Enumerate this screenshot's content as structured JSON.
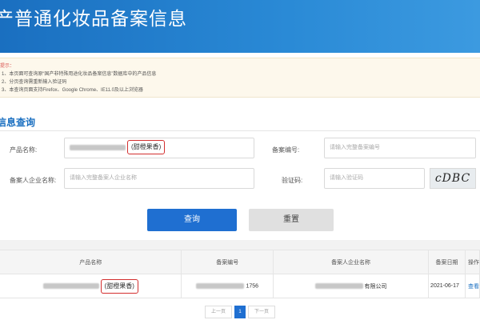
{
  "header": {
    "title": "产普通化妆品备案信息"
  },
  "notice": {
    "title": "提示：",
    "lines": [
      "1、本页面可查询原“国产非特殊用途化妆品备案信息”数据库中的产品信息",
      "2、分页查询需重新输入验证码",
      "3、本查询页面支持Firefox、Google Chrome、IE11.0及以上浏览器"
    ]
  },
  "query": {
    "section_title": "信息查询",
    "product_name_label": "产品名称:",
    "product_name_tag": "(甜橙果香)",
    "record_no_label": "备案编号:",
    "record_no_placeholder": "请输入完整备案编号",
    "company_label": "备案人企业名称:",
    "company_placeholder": "请输入完整备案人企业名称",
    "captcha_label": "验证码:",
    "captcha_placeholder": "请输入验证码",
    "captcha_text": "cDBC",
    "query_button": "查询",
    "reset_button": "重置"
  },
  "table": {
    "headers": [
      "产品名称",
      "备案编号",
      "备案人企业名称",
      "备案日期",
      "操作"
    ],
    "row": {
      "product_tag": "(甜橙果香)",
      "record_no_suffix": "1756",
      "company_suffix": "有限公司",
      "date": "2021-06-17",
      "action": "查看"
    }
  },
  "pagination": {
    "prev": "上一页",
    "current": "1",
    "next": "下一页"
  }
}
